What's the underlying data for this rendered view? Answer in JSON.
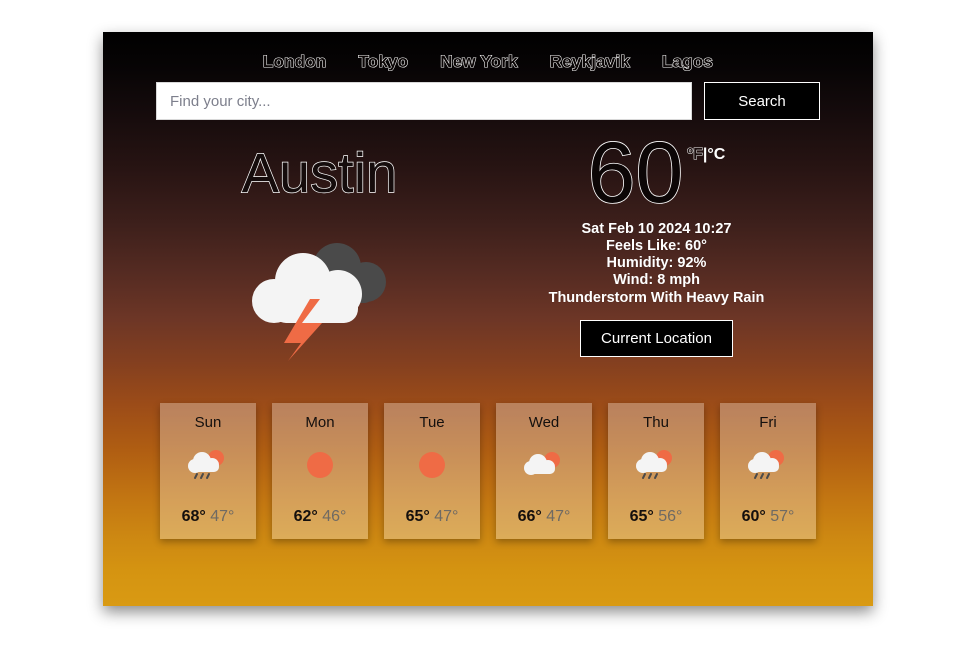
{
  "nav": {
    "links": [
      {
        "label": "London"
      },
      {
        "label": "Tokyo"
      },
      {
        "label": "New York"
      },
      {
        "label": "Reykjavik"
      },
      {
        "label": "Lagos"
      }
    ]
  },
  "search": {
    "placeholder": "Find your city...",
    "value": "",
    "button_label": "Search"
  },
  "current": {
    "city": "Austin",
    "icon": "thunderstorm-with-rain-icon",
    "temperature": "60",
    "unit_f": "ºF",
    "unit_separator": "|",
    "unit_c": "°C",
    "active_unit": "F",
    "datetime": "Sat Feb 10 2024 10:27",
    "feels_like": "Feels Like: 60°",
    "humidity": "Humidity: 92%",
    "wind": "Wind: 8 mph",
    "condition": "Thunderstorm With Heavy Rain",
    "location_button_label": "Current Location"
  },
  "forecast": [
    {
      "day": "Sun",
      "icon": "sun-behind-rain-cloud-icon",
      "high": "68°",
      "low": "47°"
    },
    {
      "day": "Mon",
      "icon": "sun-icon",
      "high": "62°",
      "low": "46°"
    },
    {
      "day": "Tue",
      "icon": "sun-icon",
      "high": "65°",
      "low": "47°"
    },
    {
      "day": "Wed",
      "icon": "sun-behind-cloud-icon",
      "high": "66°",
      "low": "47°"
    },
    {
      "day": "Thu",
      "icon": "sun-behind-rain-cloud-icon",
      "high": "65°",
      "low": "56°"
    },
    {
      "day": "Fri",
      "icon": "sun-behind-rain-cloud-icon",
      "high": "60°",
      "low": "57°"
    }
  ],
  "colors": {
    "gradient_top": "#000000",
    "gradient_mid": "#85401f",
    "gradient_bottom": "#d99a13",
    "sun": "#ef6b45",
    "cloud_light": "#f4f4f4",
    "cloud_dark": "#4a4a4a",
    "bolt": "#ef6b45"
  }
}
